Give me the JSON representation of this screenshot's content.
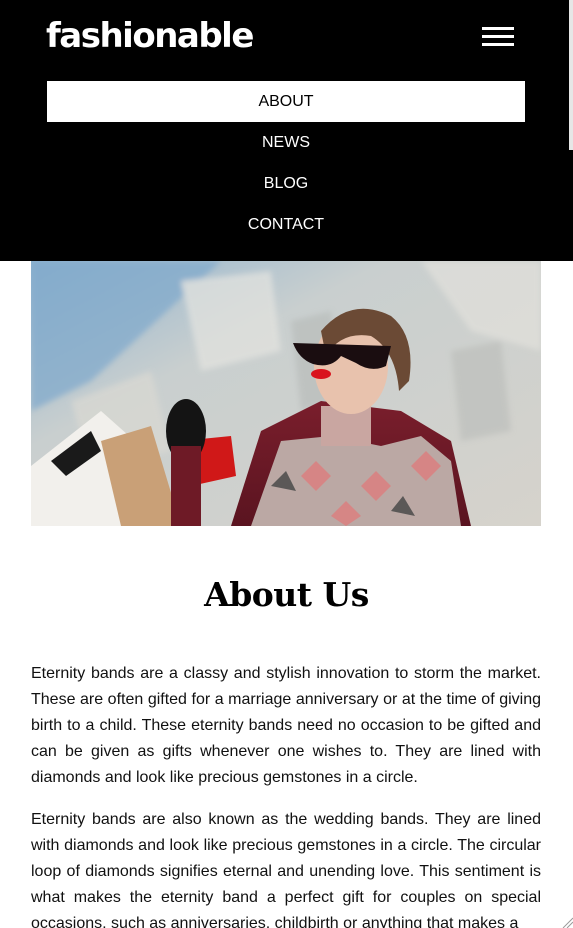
{
  "header": {
    "logo": "fashionable",
    "menu_icon": "hamburger-menu-icon",
    "background": "#000000"
  },
  "nav": {
    "items": [
      {
        "label": "ABOUT",
        "active": true
      },
      {
        "label": "NEWS",
        "active": false
      },
      {
        "label": "BLOG",
        "active": false
      },
      {
        "label": "CONTACT",
        "active": false
      }
    ]
  },
  "hero": {
    "subject": "woman in sunglasses holding shopping bags"
  },
  "about": {
    "title": "About Us",
    "paragraphs": [
      "Eternity bands are a classy and stylish innovation to storm the market. These are often gifted for a marriage anniversary or at the time of giving birth to a child. These eternity bands need no occasion to be gifted and can be given as gifts whenever one wishes to. They are lined with diamonds and look like precious gemstones in a circle.",
      "Eternity bands are also known as the wedding bands. They are lined with diamonds and look like precious gemstones in a circle. The circular loop of diamonds signifies eternal and unending love. This sentiment is what makes the eternity band a perfect gift for couples on special occasions, such as anniversaries, childbirth or anything that makes a"
    ]
  }
}
